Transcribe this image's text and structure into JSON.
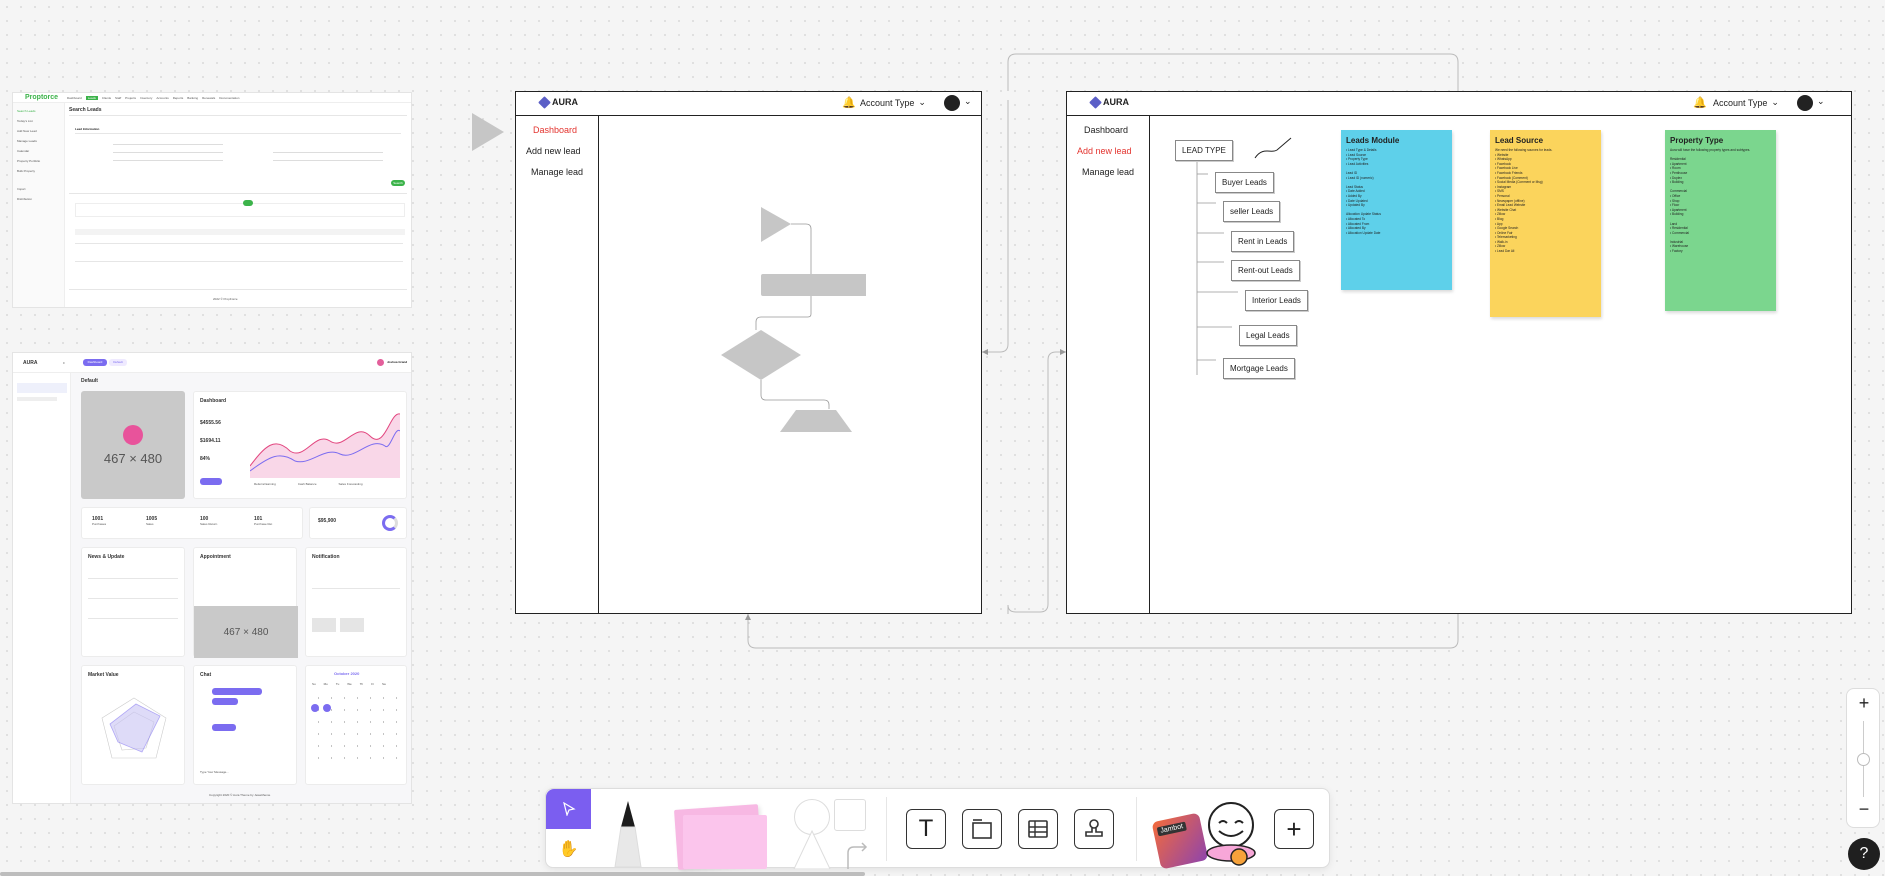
{
  "ref_top": {
    "brand": "Proptorce",
    "tabs": [
      "Dashboard",
      "Leads",
      "Clients",
      "Staff",
      "Projects",
      "Inventory",
      "Accounts",
      "Reports",
      "Banking",
      "Renewals",
      "Documentation"
    ],
    "sidebar": [
      "Search Leads",
      "Today's List",
      "Add New Lead",
      "Manage Leads",
      "Calendar",
      "Property Portfolio",
      "Bulk Property",
      "Import",
      "Distribution"
    ],
    "title": "Search Leads",
    "section": "Lead Information",
    "button": "Search",
    "footer": "2022 © PropForce"
  },
  "ref_bottom": {
    "brand": "AURA",
    "page_title": "Default",
    "header_buttons": [
      "Dashboard",
      "Default"
    ],
    "user_name": "Joshua Grand",
    "placeholder": "467 × 480",
    "dashboard": {
      "title": "Dashboard",
      "value1": "$4555.56",
      "value2": "$1694.11",
      "value3": "84%",
      "legend": [
        "Referral Earning",
        "Cash Balance",
        "Sales Forecasting"
      ]
    },
    "stats": [
      {
        "value": "1001",
        "label": "Purchases"
      },
      {
        "value": "1005",
        "label": "Sales"
      },
      {
        "value": "100",
        "label": "Sales Return"
      },
      {
        "value": "101",
        "label": "Purchase Ret"
      }
    ],
    "total": "$95,900",
    "news_title": "News & Update",
    "appointment_title": "Appointment",
    "notification_title": "Notification",
    "market_title": "Market Value",
    "chat_title": "Chat",
    "chat_placeholder": "Type Your Message...",
    "calendar_month": "October 2020",
    "calendar_days": [
      "Su",
      "Mo",
      "Tu",
      "We",
      "Th",
      "Fr",
      "Sa"
    ],
    "copyright": "Copyright 2020 © Aura Theme by Jeweltheme"
  },
  "wireframe_left": {
    "logo": "AURA",
    "account_type": "Account Type",
    "nav": [
      {
        "label": "Dashboard",
        "active": true
      },
      {
        "label": "Add new lead",
        "active": false
      },
      {
        "label": "Manage lead",
        "active": false
      }
    ]
  },
  "wireframe_right": {
    "logo": "AURA",
    "account_type": "Account Type",
    "nav": [
      {
        "label": "Dashboard",
        "active": false
      },
      {
        "label": "Add new lead",
        "active": true
      },
      {
        "label": "Manage lead",
        "active": false
      }
    ],
    "lead_type": "LEAD TYPE",
    "lead_boxes": [
      "Buyer Leads",
      "seller Leads",
      "Rent in Leads",
      "Rent-out Leads",
      "Interior Leads",
      "Legal Leads",
      "Mortgage Leads"
    ]
  },
  "stickies": {
    "leads_module": {
      "title": "Leads Module",
      "color": "#5ed0ea",
      "lines": [
        "• Lead Type & Details",
        "• Lead Source",
        "• Property Type",
        "• Lead Activities",
        "",
        "Lead ID",
        "• Lead ID (numeric)",
        "",
        "Lead Status",
        "• Date Added",
        "• Added By",
        "• Date Updated",
        "• Updated By",
        "",
        "Allocation Update Status",
        "• Allocated To",
        "• Allocated From",
        "• Allocated By",
        "• Allocation Update Date"
      ]
    },
    "lead_source": {
      "title": "Lead Source",
      "color": "#fbd45c",
      "lines": [
        "We need the following sources for leads.",
        "• Website",
        "• WhatsApp",
        "• Facebook",
        "• Facebook Live",
        "• Facebook Friends",
        "• Facebook (Comment)",
        "• Social Media (Comment or Msg)",
        "• Instagram",
        "• SMS",
        "• Personal",
        "• Newspaper (offline)",
        "• Email Lead Website",
        "• Website Chat",
        "• Zillow",
        "• Blog",
        "• App",
        "• Google Search",
        "• Online Fair",
        "• Telemarketing",
        "• Walk-in",
        "• Zillow",
        "• Lead Dar Ali"
      ]
    },
    "property_type": {
      "title": "Property Type",
      "color": "#7bd68e",
      "lines": [
        "Aura will have the following property types and subtypes.",
        "",
        "Residential",
        "• Apartment",
        "• Room",
        "• Penthouse",
        "• Duplex",
        "• Building",
        "",
        "Commercial",
        "• Office",
        "• Shop",
        "• Floor",
        "• Apartment",
        "• Building",
        "",
        "Land",
        "• Residential",
        "• Commercial",
        "",
        "Industrial",
        "• Warehouse",
        "• Factory"
      ]
    }
  },
  "toolbar": {
    "text_tool": "T",
    "sticker_label": "Jambot"
  },
  "zoom": {
    "plus": "+",
    "minus": "−",
    "level_fraction": 0.5
  },
  "help": "?"
}
